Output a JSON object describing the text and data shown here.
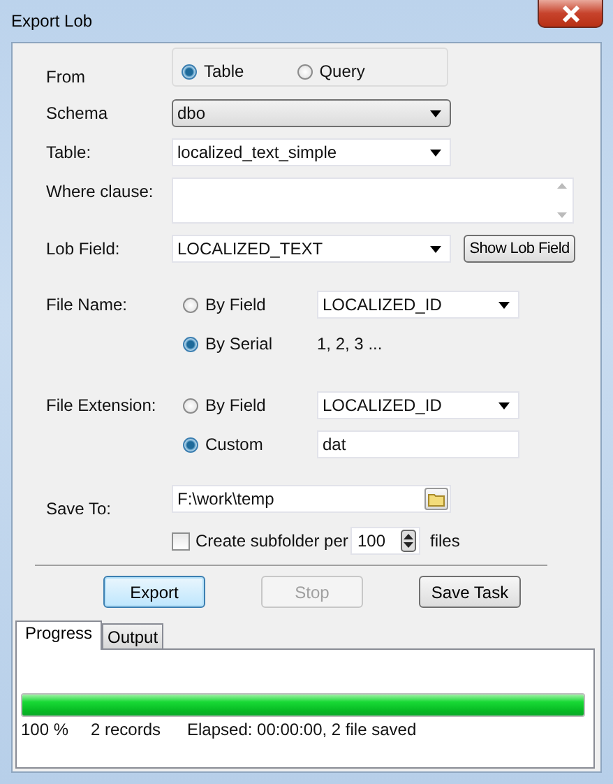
{
  "window": {
    "title": "Export Lob"
  },
  "from": {
    "label": "From",
    "options": [
      {
        "label": "Table",
        "selected": true
      },
      {
        "label": "Query",
        "selected": false
      }
    ]
  },
  "schema": {
    "label": "Schema",
    "value": "dbo"
  },
  "table": {
    "label": "Table:",
    "value": "localized_text_simple"
  },
  "where_clause": {
    "label": "Where clause:"
  },
  "lob_field": {
    "label": "Lob Field:",
    "value": "LOCALIZED_TEXT",
    "button": "Show Lob Field"
  },
  "file_name": {
    "label": "File Name:",
    "options": [
      {
        "label": "By Field",
        "selected": false,
        "kind": "combo",
        "value": "LOCALIZED_ID"
      },
      {
        "label": "By Serial",
        "selected": true,
        "kind": "text",
        "value": "1, 2, 3 ..."
      }
    ]
  },
  "file_extension": {
    "label": "File Extension:",
    "options": [
      {
        "label": "By Field",
        "selected": false,
        "kind": "combo",
        "value": "LOCALIZED_ID"
      },
      {
        "label": "Custom",
        "selected": true,
        "kind": "input",
        "value": "dat"
      }
    ]
  },
  "save_to": {
    "label": "Save To:",
    "value": "F:\\work\\temp"
  },
  "subfolder": {
    "label": "Create subfolder per",
    "checked": false,
    "count": "100",
    "unit": "files"
  },
  "buttons": [
    {
      "label": "Export",
      "focused": true,
      "disabled": false
    },
    {
      "label": "Stop",
      "focused": false,
      "disabled": true
    },
    {
      "label": "Save Task",
      "focused": false,
      "disabled": false
    }
  ],
  "tabs": [
    {
      "label": "Progress",
      "selected": true
    },
    {
      "label": "Output",
      "selected": false
    }
  ],
  "progress": {
    "level": 1,
    "percent": "100 %",
    "records": "2 records",
    "elapsed": "Elapsed: 00:00:00, 2 file saved"
  }
}
